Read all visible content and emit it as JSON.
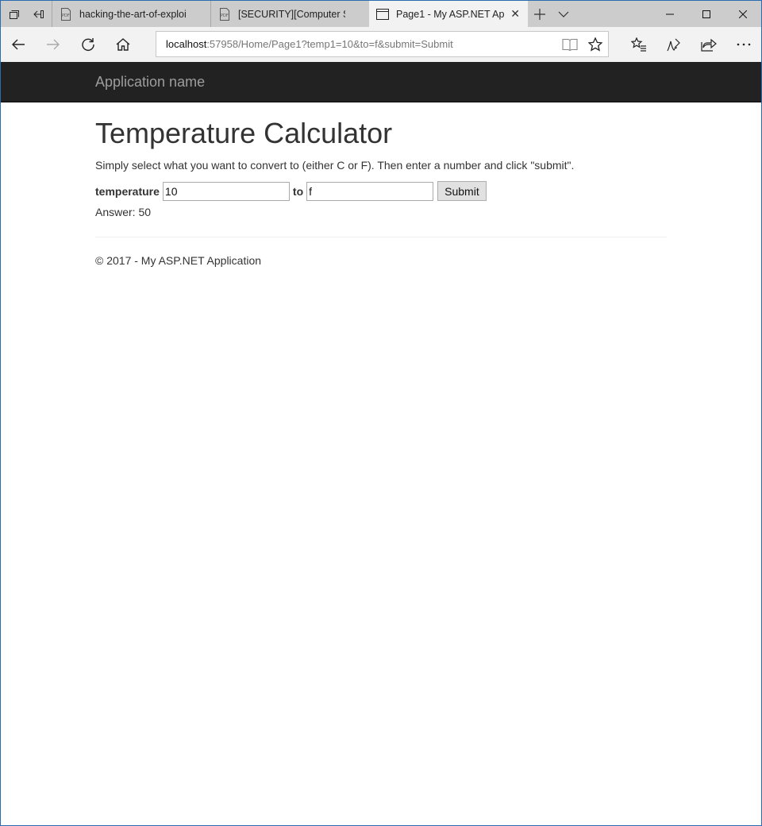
{
  "browser": {
    "tabs": [
      {
        "title": "hacking-the-art-of-exploita",
        "icon": "pdf-icon",
        "active": false
      },
      {
        "title": "[SECURITY][Computer Secu",
        "icon": "pdf-icon",
        "active": false
      },
      {
        "title": "Page1 - My ASP.NET Ap",
        "icon": "page-icon",
        "active": true
      }
    ],
    "url_host": "localhost",
    "url_path": ":57958/Home/Page1?temp1=10&to=f&submit=Submit"
  },
  "site": {
    "brand": "Application name"
  },
  "page": {
    "title": "Temperature Calculator",
    "instructions": "Simply select what you want to convert to (either C or F). Then enter a number and click \"submit\".",
    "temperature_label": "temperature",
    "temperature_value": "10",
    "to_label": "to",
    "to_value": "f",
    "submit_label": "Submit",
    "answer": "Answer: 50",
    "footer": "© 2017 - My ASP.NET Application"
  }
}
